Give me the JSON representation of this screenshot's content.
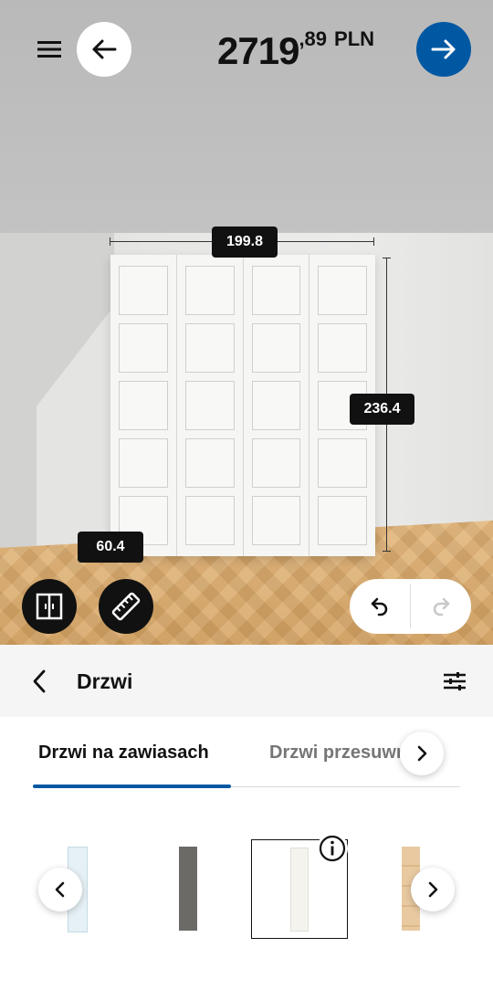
{
  "topbar": {
    "price_integer": "2719",
    "price_decimal": ",89",
    "currency": "PLN",
    "menu_icon": "hamburger-menu-icon",
    "back_icon": "arrow-left-icon",
    "next_icon": "arrow-right-icon"
  },
  "viewport": {
    "dimensions": {
      "width": "199.8",
      "height": "236.4",
      "depth": "60.4"
    },
    "tools": {
      "wardrobe_icon": "wardrobe-doors-icon",
      "measure_icon": "ruler-icon",
      "undo_icon": "undo-icon",
      "redo_icon": "redo-icon"
    }
  },
  "section": {
    "title": "Drzwi",
    "back_icon": "chevron-left-icon",
    "filter_icon": "filter-sliders-icon"
  },
  "tabs": [
    {
      "label": "Drzwi na zawiasach",
      "active": true
    },
    {
      "label": "Drzwi przesuwne",
      "active": false
    }
  ],
  "products": {
    "items": [
      {
        "name": "glass-door",
        "color": "#e6f1f5"
      },
      {
        "name": "dark-grey-door",
        "color": "#6c6a67"
      },
      {
        "name": "white-door",
        "color": "#f4f3ee",
        "selected": true
      },
      {
        "name": "oak-door",
        "color": "#e8c9a0"
      }
    ],
    "info_icon": "info-icon"
  },
  "colors": {
    "accent": "#0058a3",
    "dark": "#111111"
  }
}
